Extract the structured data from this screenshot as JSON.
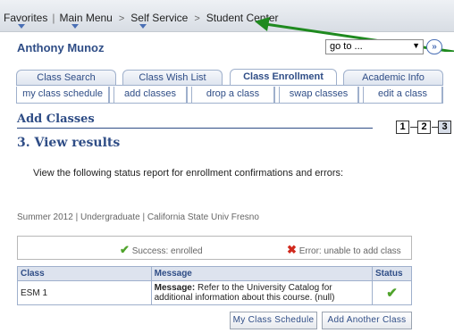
{
  "breadcrumb": {
    "favorites": "Favorites",
    "main_menu": "Main Menu",
    "self_service": "Self Service",
    "student_center": "Student Center"
  },
  "header": {
    "user_name": "Anthony Munoz",
    "goto_value": "go to ...",
    "goto_button": "»"
  },
  "tabs": [
    {
      "label": "Class Search"
    },
    {
      "label": "Class Wish List"
    },
    {
      "label": "Class Enrollment"
    },
    {
      "label": "Academic Info"
    }
  ],
  "subtabs": [
    {
      "label": "my class schedule"
    },
    {
      "label": "add classes"
    },
    {
      "label": "drop a class"
    },
    {
      "label": "swap classes"
    },
    {
      "label": "edit a class"
    }
  ],
  "page": {
    "title": "Add Classes",
    "step_title": "3.  View results",
    "instructions": "View the following status report for enrollment confirmations and errors:",
    "term_info": "Summer 2012 | Undergraduate | California State Univ  Fresno"
  },
  "steps": [
    "1",
    "2",
    "3"
  ],
  "legend": {
    "success": "Success: enrolled",
    "error": "Error: unable to add class"
  },
  "results": {
    "columns": [
      "Class",
      "Message",
      "Status"
    ],
    "rows": [
      {
        "class": "ESM  1",
        "message_label": "Message:",
        "message_text": " Refer to the University Catalog for additional information about this course. (null)"
      }
    ]
  },
  "actions": {
    "my_schedule": "My Class Schedule",
    "add_another": "Add Another Class"
  },
  "colors": {
    "accent": "#2f4d86",
    "arrow": "#1f8a1f",
    "success": "#4fa32b",
    "error": "#d12a1e"
  }
}
